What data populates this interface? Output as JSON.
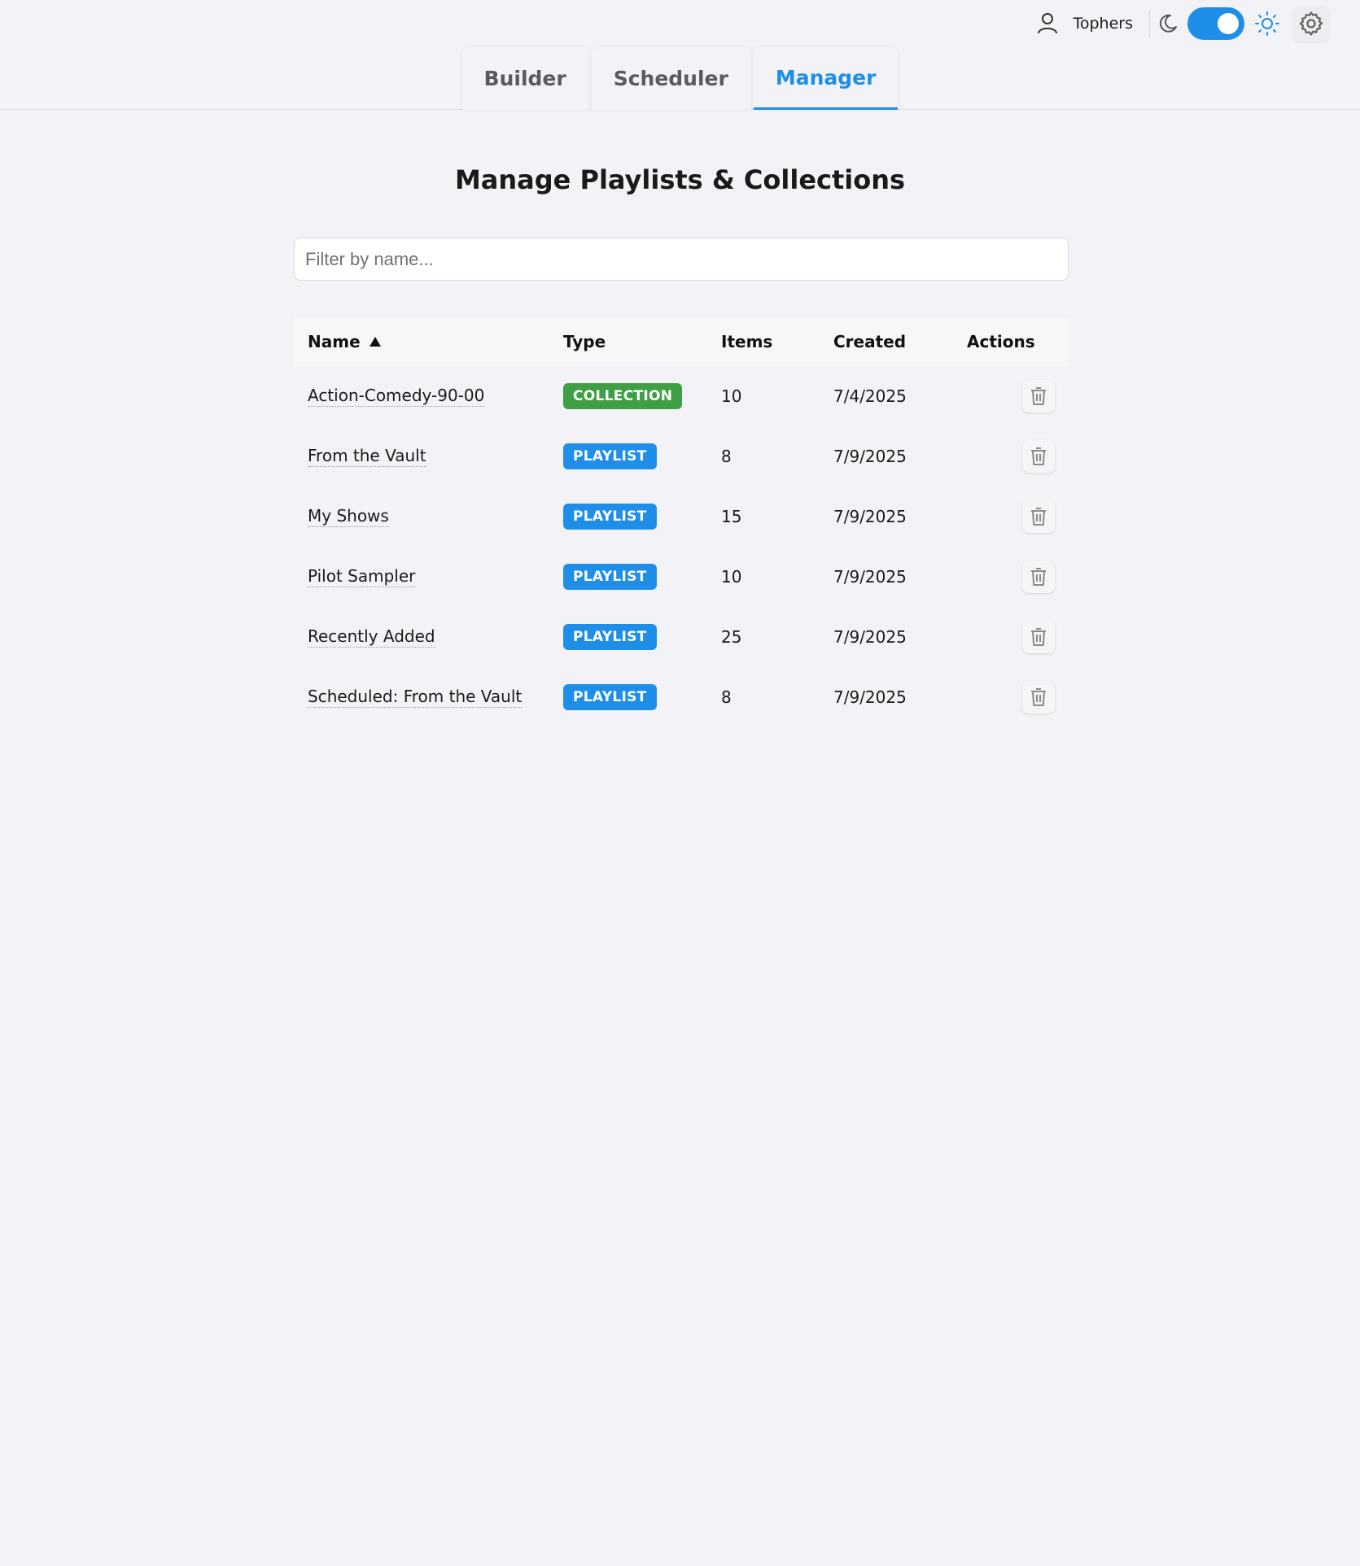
{
  "header": {
    "username": "Tophers",
    "theme_toggle": {
      "state": "on",
      "color": "#1e8ee8"
    },
    "icons": [
      "user-icon",
      "moon-icon",
      "sun-icon",
      "gear-icon"
    ]
  },
  "tabs": [
    {
      "label": "Builder",
      "active": false
    },
    {
      "label": "Scheduler",
      "active": false
    },
    {
      "label": "Manager",
      "active": true
    }
  ],
  "page": {
    "title": "Manage Playlists & Collections",
    "filter_placeholder": "Filter by name..."
  },
  "table": {
    "headers": {
      "name": "Name",
      "type": "Type",
      "items": "Items",
      "created": "Created",
      "actions": "Actions"
    },
    "sort_icon": "triangle-up-icon",
    "rows": [
      {
        "name": "Action-Comedy-90-00",
        "type": "COLLECTION",
        "items": "10",
        "created": "7/4/2025"
      },
      {
        "name": "From the Vault",
        "type": "PLAYLIST",
        "items": "8",
        "created": "7/9/2025"
      },
      {
        "name": "My Shows",
        "type": "PLAYLIST",
        "items": "15",
        "created": "7/9/2025"
      },
      {
        "name": "Pilot Sampler",
        "type": "PLAYLIST",
        "items": "10",
        "created": "7/9/2025"
      },
      {
        "name": "Recently Added",
        "type": "PLAYLIST",
        "items": "25",
        "created": "7/9/2025"
      },
      {
        "name": "Scheduled: From the Vault",
        "type": "PLAYLIST",
        "items": "8",
        "created": "7/9/2025"
      }
    ]
  },
  "colors": {
    "accent": "#1e8ee8",
    "collection": "#3f9f45",
    "playlist": "#1e8ee8",
    "background": "#f3f3f7"
  }
}
